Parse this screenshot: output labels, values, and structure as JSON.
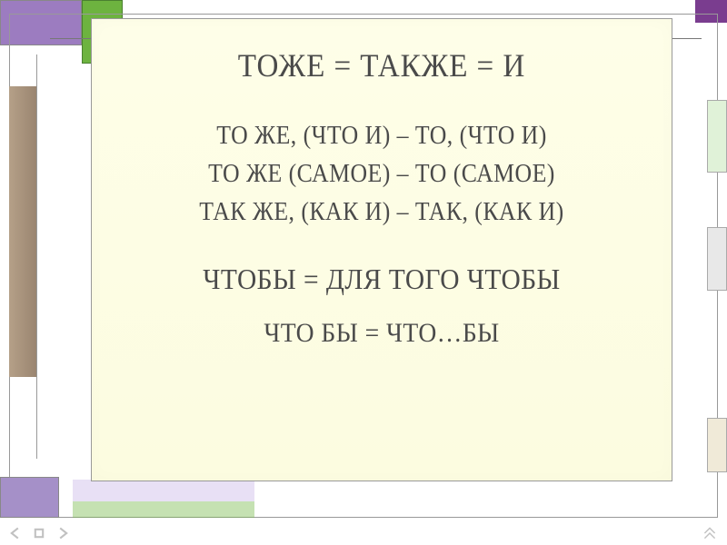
{
  "slide": {
    "title": "ТОЖЕ = ТАКЖЕ = И",
    "lines": [
      "ТО  ЖЕ, (ЧТО И) – ТО, (ЧТО И)",
      "ТО  ЖЕ (САМОЕ) – ТО (САМОЕ)",
      "ТАК  ЖЕ, (КАК И) – ТАК, (КАК И)"
    ],
    "subtitle": "ЧТОБЫ = ДЛЯ ТОГО ЧТОБЫ",
    "footer": "ЧТО  БЫ = ЧТО…БЫ"
  }
}
